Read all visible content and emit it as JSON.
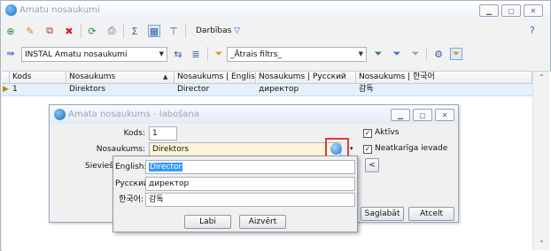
{
  "window": {
    "title": "Amatu nosaukumi",
    "buttons": [
      "minimize",
      "maximize",
      "close"
    ]
  },
  "toolbar": {
    "actions_label": "Darbības",
    "help": "?",
    "icons": [
      "new-icon",
      "edit-icon",
      "copy-icon",
      "delete-icon",
      "refresh-icon",
      "print-icon",
      "sum-icon",
      "grid-icon",
      "tree-icon"
    ]
  },
  "filterbar": {
    "view_value": "INSTAL Amatu nosaukumi",
    "quick_filter_value": "_Ātrais filtrs_"
  },
  "grid": {
    "columns": [
      "Kods",
      "Nosaukums",
      "Nosaukums | English",
      "Nosaukums | Русский",
      "Nosaukums | 한국어"
    ],
    "sort_indicator": "▲",
    "rows": [
      {
        "marker": "▶",
        "cells": [
          "1",
          "Direktors",
          "Director",
          "директор",
          "감독"
        ]
      }
    ]
  },
  "dialog": {
    "title": "Amata nosaukums - labošana",
    "code_label": "Kods:",
    "code_value": "1",
    "name_label": "Nosaukums:",
    "name_value": "Direktors",
    "active_label": "Aktīvs",
    "active_checked": "✓",
    "independent_label": "Neatkarīga ievade",
    "independent_checked": "✓",
    "cut_label": "Sieviešu",
    "arrow_button": "<",
    "save_button": "Saglabāt",
    "cancel_button": "Atcelt"
  },
  "translations": {
    "rows": [
      {
        "lang": "English:",
        "value": "Director"
      },
      {
        "lang": "Русский:",
        "value": "директор"
      },
      {
        "lang": "한국어:",
        "value": "감독"
      }
    ],
    "ok_button": "Labi",
    "close_button": "Aizvērt"
  },
  "colors": {
    "highlight_box": "#e03a3a",
    "selection": "#3399ff",
    "row_selected": "#e4f0fb"
  }
}
